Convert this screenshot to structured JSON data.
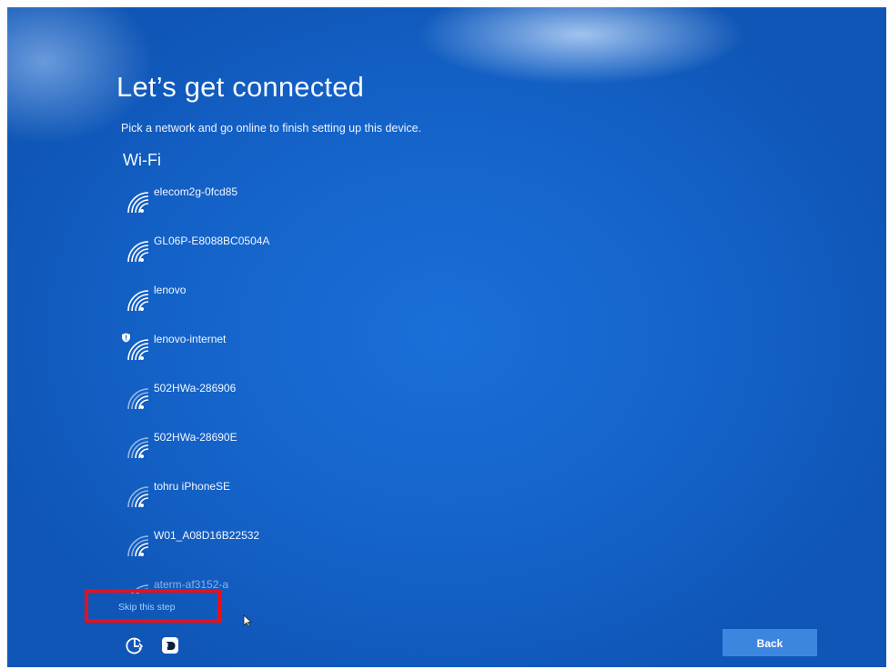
{
  "setup": {
    "title": "Let’s get connected",
    "subtitle": "Pick a network and go online to finish setting up this device.",
    "section_label": "Wi-Fi"
  },
  "networks": [
    {
      "ssid": "elecom2g-0fcd85",
      "secured": false
    },
    {
      "ssid": "GL06P-E8088BC0504A",
      "secured": false
    },
    {
      "ssid": "lenovo",
      "secured": false
    },
    {
      "ssid": "lenovo-internet",
      "secured": true
    },
    {
      "ssid": "502HWa-286906",
      "secured": false
    },
    {
      "ssid": "502HWa-28690E",
      "secured": false
    },
    {
      "ssid": "tohru iPhoneSE",
      "secured": false
    },
    {
      "ssid": "W01_A08D16B22532",
      "secured": false
    },
    {
      "ssid": "aterm-af3152-a",
      "secured": false
    }
  ],
  "footer": {
    "skip_label": "Skip this step",
    "back_label": "Back",
    "accessibility_icon": "ease-of-access-icon",
    "narrator_icon": "narrator-icon"
  },
  "colors": {
    "background": "#1462c8",
    "link": "#9fd0ff",
    "button": "#3c86e0",
    "highlight_box": "#e8101a"
  }
}
